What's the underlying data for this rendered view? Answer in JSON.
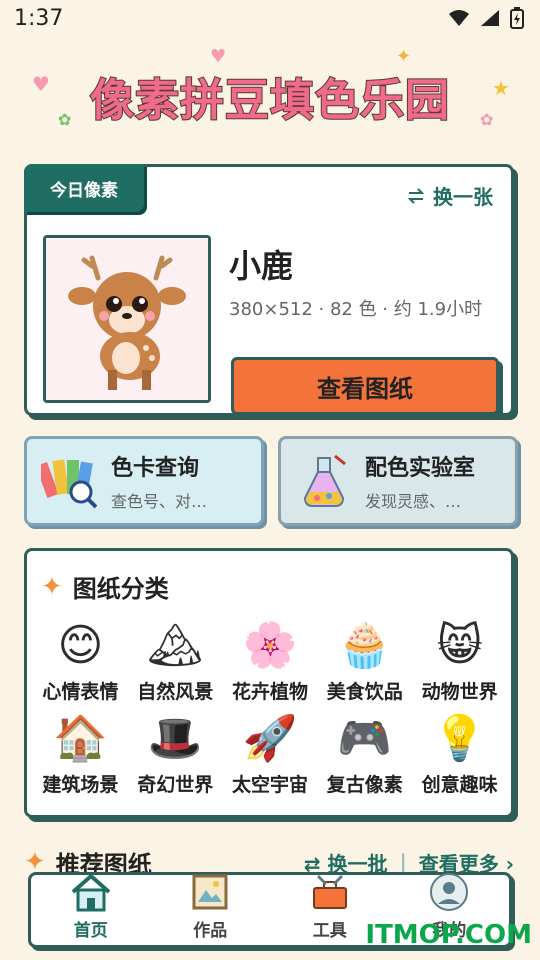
{
  "status": {
    "time": "1:37"
  },
  "app": {
    "title": "像素拼豆填色乐园"
  },
  "today": {
    "badge": "今日像素",
    "swap_label": "换一张",
    "name": "小鹿",
    "meta": "380×512 · 82 色 · 约 1.9小时",
    "view_button": "查看图纸"
  },
  "tools": [
    {
      "title": "色卡查询",
      "subtitle": "查色号、对…",
      "icon": "color-swatch-icon"
    },
    {
      "title": "配色实验室",
      "subtitle": "发现灵感、…",
      "icon": "potion-flask-icon"
    }
  ],
  "categories": {
    "title": "图纸分类",
    "items": [
      {
        "label": "心情表情",
        "icon": "emoji-face-icon",
        "glyph": "😊"
      },
      {
        "label": "自然风景",
        "icon": "mountain-tree-icon",
        "glyph": "🏔"
      },
      {
        "label": "花卉植物",
        "icon": "flower-icon",
        "glyph": "🌸"
      },
      {
        "label": "美食饮品",
        "icon": "cupcake-icon",
        "glyph": "🧁"
      },
      {
        "label": "动物世界",
        "icon": "cat-face-icon",
        "glyph": "😸"
      },
      {
        "label": "建筑场景",
        "icon": "house-icon",
        "glyph": "🏠"
      },
      {
        "label": "奇幻世界",
        "icon": "wizard-hat-icon",
        "glyph": "🎩"
      },
      {
        "label": "太空宇宙",
        "icon": "rocket-icon",
        "glyph": "🚀"
      },
      {
        "label": "复古像素",
        "icon": "game-console-icon",
        "glyph": "🎮"
      },
      {
        "label": "创意趣味",
        "icon": "lightbulb-icon",
        "glyph": "💡"
      }
    ]
  },
  "recommended": {
    "title": "推荐图纸",
    "refresh_label": "换一批",
    "more_label": "查看更多"
  },
  "nav": {
    "items": [
      {
        "label": "首页",
        "icon": "home-icon",
        "active": true
      },
      {
        "label": "作品",
        "icon": "picture-frame-icon",
        "active": false
      },
      {
        "label": "工具",
        "icon": "toolbox-icon",
        "active": false
      },
      {
        "label": "我的",
        "icon": "avatar-icon",
        "active": false
      }
    ]
  },
  "watermark": "ITMOP.COM",
  "colors": {
    "background": "#fbf3e3",
    "accent": "#1f6d63",
    "button": "#f4733b",
    "border": "#2f5d5a"
  }
}
